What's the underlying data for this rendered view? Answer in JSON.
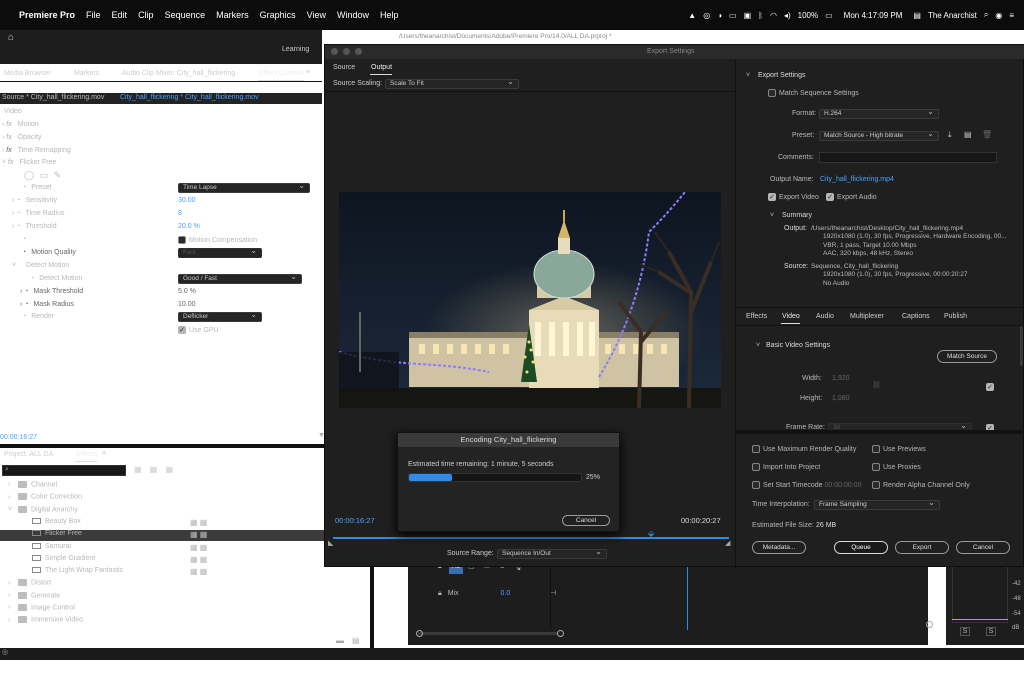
{
  "menubar": {
    "apple": "",
    "app": "Premiere Pro",
    "items": [
      "File",
      "Edit",
      "Clip",
      "Sequence",
      "Markers",
      "Graphics",
      "View",
      "Window",
      "Help"
    ],
    "battery": "100%",
    "clock": "Mon 4:17:09 PM",
    "user": "The Anarchist"
  },
  "window": {
    "path": "/Users/theanarchist/Documents/Adobe/Premiere Pro/14.0/ALL DA.prproj *"
  },
  "workspace": {
    "learning": "Learning"
  },
  "panels_top": {
    "media_browser": "Media Browser",
    "markers": "Markers",
    "audio_clip_mixer": "Audio Clip Mixer: City_hall_flickering",
    "effect_controls": "Effect Controls"
  },
  "effect_controls": {
    "source": "Source * City_hall_flickering.mov",
    "clip": "City_hall_flickering * City_hall_flickering.mov",
    "video_label": "Video",
    "motion": "Motion",
    "opacity": "Opacity",
    "time_remapping": "Time Remapping",
    "flicker_free": "Flicker Free",
    "preset_label": "Preset",
    "preset_value": "Time Lapse",
    "sensitivity_label": "Sensitivity",
    "sensitivity_value": "30.00",
    "time_radius_label": "Time Radius",
    "time_radius_value": "8",
    "threshold_label": "Threshold",
    "threshold_value": "20.0 %",
    "motion_comp": "Motion Compensation",
    "motion_quality_label": "Motion Quality",
    "motion_quality_value": "Fast",
    "detect_motion_group": "Detect Motion",
    "detect_motion_label": "Detect Motion",
    "detect_motion_value": "Good / Fast",
    "mask_threshold_label": "Mask Threshold",
    "mask_threshold_value": "5.0 %",
    "mask_radius_label": "Mask Radius",
    "mask_radius_value": "10.00",
    "render_label": "Render",
    "render_value": "Deflicker",
    "use_gpu": "Use GPU",
    "timecode": "00:00:16:27"
  },
  "project": {
    "tab_project": "Project: ALL DA",
    "tab_effects": "Effects",
    "items": [
      {
        "label": "Channel",
        "type": "folder",
        "indent": 1
      },
      {
        "label": "Color Correction",
        "type": "folder",
        "indent": 1
      },
      {
        "label": "Digital Anarchy",
        "type": "folder",
        "indent": 1
      },
      {
        "label": "Beauty Box",
        "type": "fx",
        "indent": 2
      },
      {
        "label": "Flicker Free",
        "type": "fx",
        "indent": 2
      },
      {
        "label": "Samurai",
        "type": "fx",
        "indent": 2
      },
      {
        "label": "Simple Gradient",
        "type": "fx",
        "indent": 2
      },
      {
        "label": "The Light Wrap Fantastic",
        "type": "fx",
        "indent": 2
      },
      {
        "label": "Distort",
        "type": "folder",
        "indent": 1
      },
      {
        "label": "Generate",
        "type": "folder",
        "indent": 1
      },
      {
        "label": "Image Control",
        "type": "folder",
        "indent": 1
      },
      {
        "label": "Immersive Video",
        "type": "folder",
        "indent": 1
      }
    ]
  },
  "export": {
    "title": "Export Settings",
    "tab_source": "Source",
    "tab_output": "Output",
    "source_scaling_label": "Source Scaling:",
    "source_scaling_value": "Scale To Fit",
    "time_start": "00:00:16:27",
    "time_end": "00:00:20:27",
    "source_range_label": "Source Range:",
    "source_range_value": "Sequence In/Out",
    "settings_header": "Export Settings",
    "match_sequence": "Match Sequence Settings",
    "format_label": "Format:",
    "format_value": "H.264",
    "preset_label": "Preset:",
    "preset_value": "Match Source - High bitrate",
    "comments_label": "Comments:",
    "output_name_label": "Output Name:",
    "output_name_value": "City_hall_flickering.mp4",
    "export_video": "Export Video",
    "export_audio": "Export Audio",
    "summary_header": "Summary",
    "summary_output_label": "Output:",
    "summary_output_lines": [
      "/Users/theanarchist/Desktop/City_hall_flickering.mp4",
      "1920x1080 (1.0), 30 fps, Progressive, Hardware Encoding, 00...",
      "VBR, 1 pass, Target 10.00 Mbps",
      "AAC, 320 kbps, 48 kHz, Stereo"
    ],
    "summary_source_label": "Source:",
    "summary_source_lines": [
      "Sequence, City_hall_flickering",
      "1920x1080 (1.0), 30 fps, Progressive, 00:00:20:27",
      "No Audio"
    ],
    "tabs": [
      "Effects",
      "Video",
      "Audio",
      "Multiplexer",
      "Captions",
      "Publish"
    ],
    "basic_video": "Basic Video Settings",
    "match_source": "Match Source",
    "width_label": "Width:",
    "width_value": "1,920",
    "height_label": "Height:",
    "height_value": "1,080",
    "frame_rate_label": "Frame Rate:",
    "frame_rate_value": "30",
    "use_max_render": "Use Maximum Render Quality",
    "use_previews": "Use Previews",
    "import_project": "Import Into Project",
    "use_proxies": "Use Proxies",
    "set_start_tc": "Set Start Timecode",
    "start_tc_value": "00:00:00:00",
    "render_alpha": "Render Alpha Channel Only",
    "time_interp_label": "Time Interpolation:",
    "time_interp_value": "Frame Sampling",
    "file_size_label": "Estimated File Size:",
    "file_size_value": "26 MB",
    "btn_metadata": "Metadata...",
    "btn_queue": "Queue",
    "btn_export": "Export",
    "btn_cancel": "Cancel"
  },
  "encoding": {
    "title": "Encoding City_hall_flickering",
    "remaining": "Estimated time remaining: 1 minute, 5 seconds",
    "progress": 0.25,
    "percent": "25%",
    "cancel": "Cancel"
  },
  "timeline": {
    "track_a3": "A3",
    "mix": "Mix",
    "mix_value": "0.0",
    "m": "M",
    "s": "S"
  },
  "meter": {
    "labels": [
      "-42",
      "-48",
      "-54",
      "dB"
    ],
    "s1": "S",
    "s2": "S"
  },
  "colors": {
    "accent": "#2d8ceb",
    "bg": "#1d1d1d",
    "menubar": "#0c0c0c"
  }
}
